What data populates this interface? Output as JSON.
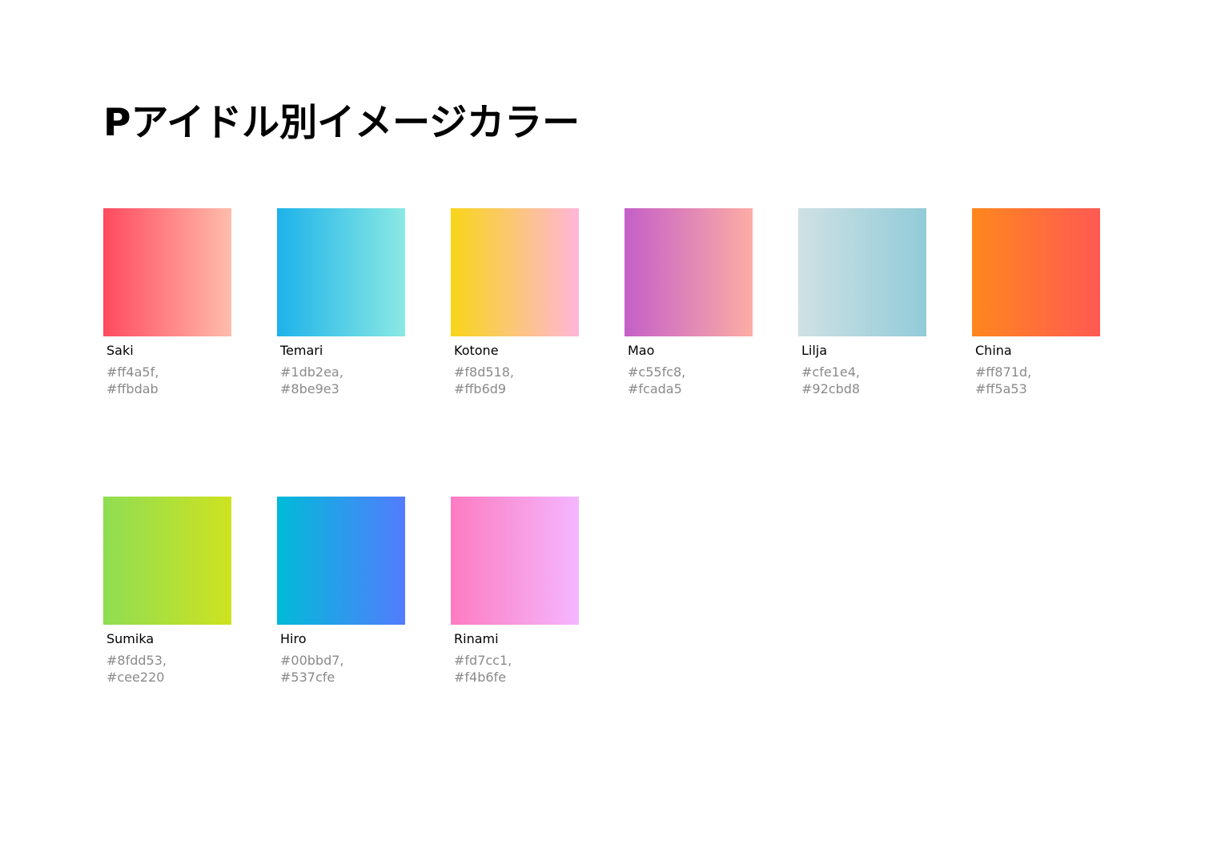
{
  "title": "Pアイドル別イメージカラー",
  "idols": [
    {
      "name": "Saki",
      "code1": "#ff4a5f,",
      "code2": "#ffbdab",
      "from": "#ff4a5f",
      "to": "#ffbdab"
    },
    {
      "name": "Temari",
      "code1": "#1db2ea,",
      "code2": "#8be9e3",
      "from": "#1db2ea",
      "to": "#8be9e3"
    },
    {
      "name": "Kotone",
      "code1": "#f8d518,",
      "code2": "#ffb6d9",
      "from": "#f8d518",
      "to": "#ffb6d9"
    },
    {
      "name": "Mao",
      "code1": "#c55fc8,",
      "code2": "#fcada5",
      "from": "#c55fc8",
      "to": "#fcada5"
    },
    {
      "name": "Lilja",
      "code1": "#cfe1e4,",
      "code2": "#92cbd8",
      "from": "#cfe1e4",
      "to": "#92cbd8"
    },
    {
      "name": "China",
      "code1": "#ff871d,",
      "code2": "#ff5a53",
      "from": "#ff871d",
      "to": "#ff5a53"
    },
    {
      "name": "Sumika",
      "code1": "#8fdd53,",
      "code2": "#cee220",
      "from": "#8fdd53",
      "to": "#cee220"
    },
    {
      "name": "Hiro",
      "code1": "#00bbd7,",
      "code2": "#537cfe",
      "from": "#00bbd7",
      "to": "#537cfe"
    },
    {
      "name": "Rinami",
      "code1": "#fd7cc1,",
      "code2": "#f4b6fe",
      "from": "#fd7cc1",
      "to": "#f4b6fe"
    }
  ]
}
